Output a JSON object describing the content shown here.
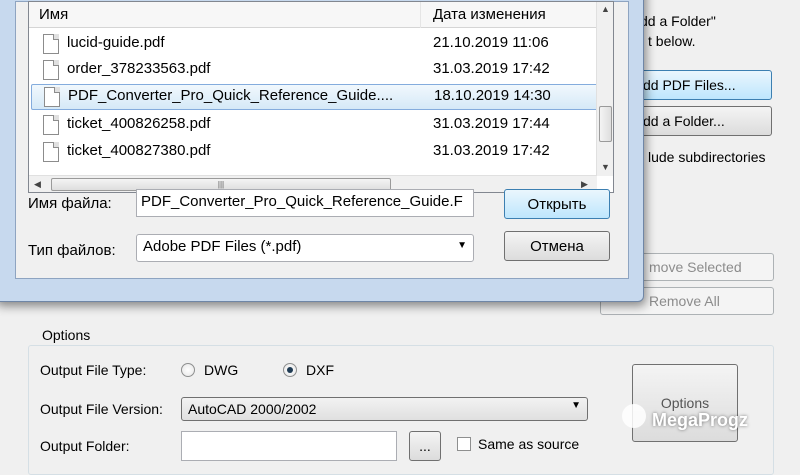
{
  "main_window": {
    "hint_line1": "dd a Folder\"",
    "hint_line2": "t below.",
    "add_pdf_files_label": "dd PDF Files...",
    "add_folder_label": "dd a Folder...",
    "include_subdirs_label": "lude subdirectories",
    "remove_selected_label": "move Selected",
    "remove_all_label": "Remove All",
    "options": {
      "legend": "Options",
      "output_file_type_label": "Output File Type:",
      "dwg_label": "DWG",
      "dxf_label": "DXF",
      "selected_type": "DXF",
      "output_file_version_label": "Output File Version:",
      "output_file_version_value": "AutoCAD 2000/2002",
      "output_folder_label": "Output Folder:",
      "output_folder_value": "",
      "browse_label": "...",
      "same_as_source_label": "Same as source",
      "options_button_label": "Options"
    }
  },
  "open_dialog": {
    "columns": {
      "name": "Имя",
      "date": "Дата изменения"
    },
    "files": [
      {
        "name": "lucid-guide.pdf",
        "date": "21.10.2019 11:06",
        "selected": false
      },
      {
        "name": "order_378233563.pdf",
        "date": "31.03.2019 17:42",
        "selected": false
      },
      {
        "name": "PDF_Converter_Pro_Quick_Reference_Guide....",
        "date": "18.10.2019 14:30",
        "selected": true
      },
      {
        "name": "ticket_400826258.pdf",
        "date": "31.03.2019 17:44",
        "selected": false
      },
      {
        "name": "ticket_400827380.pdf",
        "date": "31.03.2019 17:42",
        "selected": false
      }
    ],
    "filename_label": "Имя файла:",
    "filename_value": "PDF_Converter_Pro_Quick_Reference_Guide.F",
    "filetype_label": "Тип файлов:",
    "filetype_value": "Adobe PDF Files (*.pdf)",
    "open_label": "Открыть",
    "cancel_label": "Отмена"
  },
  "watermark": "MegaProgz",
  "colors": {
    "selection_border": "#84acdd",
    "dialog_frame": "#c7d9ee",
    "default_button": "#3c7fb1"
  }
}
